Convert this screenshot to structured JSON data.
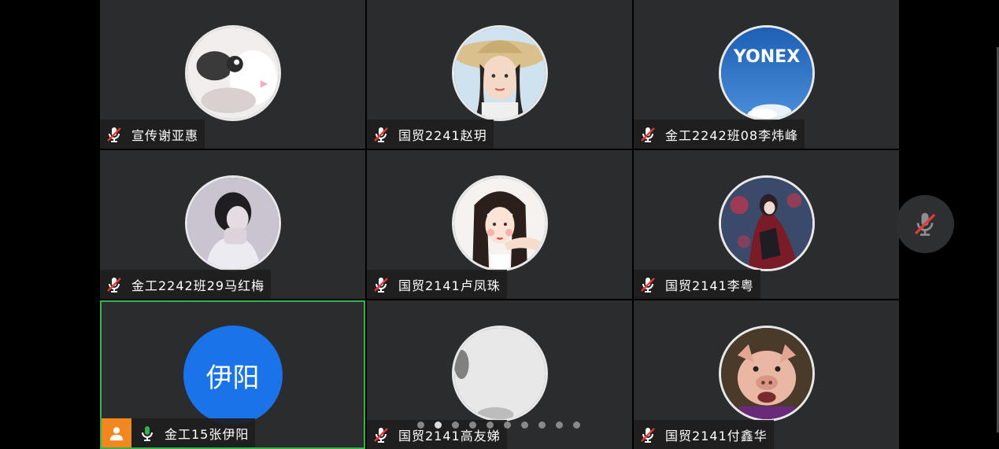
{
  "participants": [
    {
      "name": "宣传谢亚惠",
      "avatar": "cat-photo",
      "muted": true
    },
    {
      "name": "国贸2241赵玥",
      "avatar": "girl-straw-hat-photo",
      "muted": true
    },
    {
      "name": "金工2242班08李炜峰",
      "avatar": "yonex-logo",
      "muted": true
    },
    {
      "name": "金工2242班29马红梅",
      "avatar": "person-covering-face-photo",
      "muted": true
    },
    {
      "name": "国贸2141卢凤珠",
      "avatar": "illustrated-girl",
      "muted": true
    },
    {
      "name": "国贸2141李粤",
      "avatar": "anime-red-cape",
      "muted": true
    },
    {
      "name": "金工15张伊阳",
      "avatar_initials": "伊阳",
      "muted": false,
      "is_me": true
    },
    {
      "name": "国贸2141高友娣",
      "avatar": "blurry-white-photo",
      "muted": true
    },
    {
      "name": "国贸2141付鑫华",
      "avatar": "pig-photo",
      "muted": true
    }
  ],
  "logo_text": "YONEX",
  "pagination": {
    "total": 10,
    "current": 2
  },
  "colors": {
    "tile_bg": "#2b2c2e",
    "active_border": "#35b24a",
    "muted_mic": "#e53935",
    "unmuted_mic": "#35b24a",
    "initials_bg": "#1a73e8",
    "me_badge": "#f3871f"
  },
  "icons": {
    "muted": "mic-off-icon",
    "unmuted": "mic-on-icon",
    "me": "person-icon",
    "side_button": "mic-off-icon"
  }
}
